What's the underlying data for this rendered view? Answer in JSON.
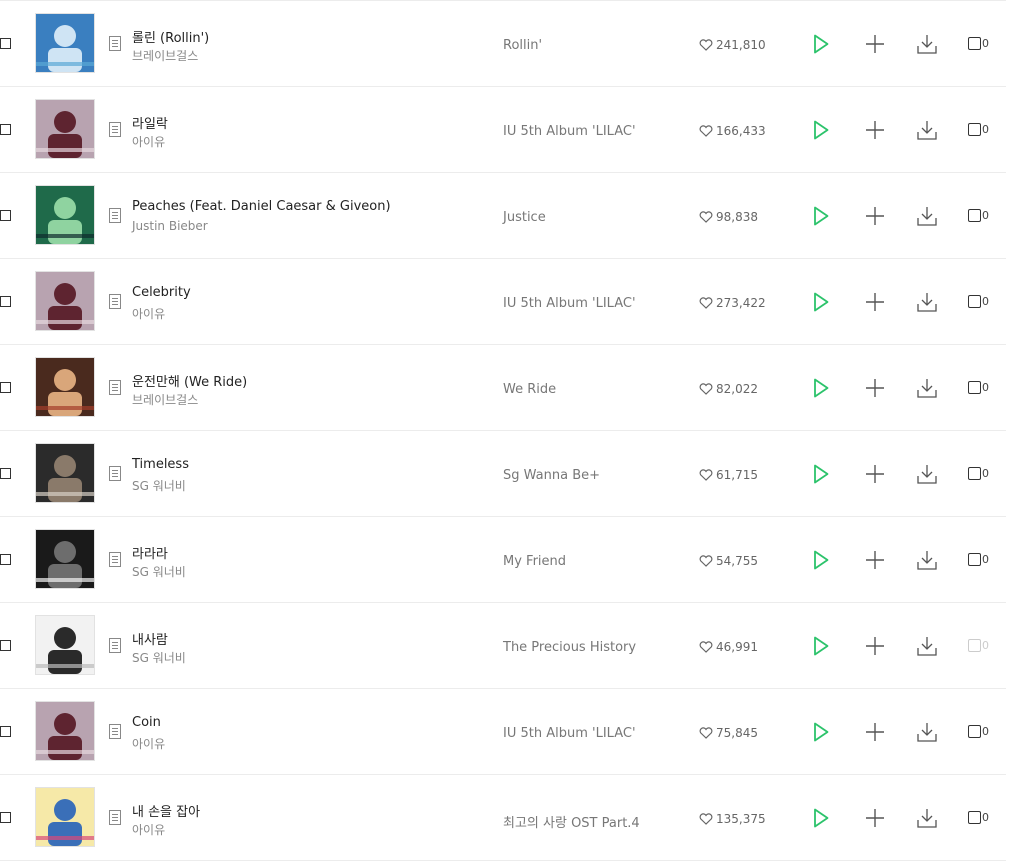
{
  "rows": [
    {
      "title": "롤린 (Rollin')",
      "artist": "브레이브걸스",
      "album": "Rollin'",
      "likes": "241,810",
      "mv_count": "0",
      "mv_disabled": false,
      "art": {
        "bg": "#3a7fc0",
        "fg": "#cfe4f4",
        "accent": "#5aa8d6"
      }
    },
    {
      "title": "라일락",
      "artist": "아이유",
      "album": "IU 5th Album 'LILAC'",
      "likes": "166,433",
      "mv_count": "0",
      "mv_disabled": false,
      "art": {
        "bg": "#b8a3b0",
        "fg": "#5e2430",
        "accent": "#e6d7de"
      }
    },
    {
      "title": "Peaches (Feat. Daniel Caesar & Giveon)",
      "artist": "Justin Bieber",
      "album": "Justice",
      "likes": "98,838",
      "mv_count": "0",
      "mv_disabled": false,
      "art": {
        "bg": "#1f6a4a",
        "fg": "#8fd3a0",
        "accent": "#0e2c2c"
      }
    },
    {
      "title": "Celebrity",
      "artist": "아이유",
      "album": "IU 5th Album 'LILAC'",
      "likes": "273,422",
      "mv_count": "0",
      "mv_disabled": false,
      "art": {
        "bg": "#b8a3b0",
        "fg": "#5e2430",
        "accent": "#e6d7de"
      }
    },
    {
      "title": "운전만해 (We Ride)",
      "artist": "브레이브걸스",
      "album": "We Ride",
      "likes": "82,022",
      "mv_count": "0",
      "mv_disabled": false,
      "art": {
        "bg": "#4a2a1e",
        "fg": "#d9a67a",
        "accent": "#a33d2a"
      }
    },
    {
      "title": "Timeless",
      "artist": "SG 워너비",
      "album": "Sg Wanna Be+",
      "likes": "61,715",
      "mv_count": "0",
      "mv_disabled": false,
      "art": {
        "bg": "#2b2b2b",
        "fg": "#8a7a6a",
        "accent": "#d6cfc4"
      }
    },
    {
      "title": "라라라",
      "artist": "SG 워너비",
      "album": "My Friend",
      "likes": "54,755",
      "mv_count": "0",
      "mv_disabled": false,
      "art": {
        "bg": "#1a1a1a",
        "fg": "#6d6d6d",
        "accent": "#f4f4f4"
      }
    },
    {
      "title": "내사람",
      "artist": "SG 워너비",
      "album": "The Precious History",
      "likes": "46,991",
      "mv_count": "0",
      "mv_disabled": true,
      "art": {
        "bg": "#f2f2f2",
        "fg": "#2a2a2a",
        "accent": "#bbbbbb"
      }
    },
    {
      "title": "Coin",
      "artist": "아이유",
      "album": "IU 5th Album 'LILAC'",
      "likes": "75,845",
      "mv_count": "0",
      "mv_disabled": false,
      "art": {
        "bg": "#b8a3b0",
        "fg": "#5e2430",
        "accent": "#e6d7de"
      }
    },
    {
      "title": "내 손을 잡아",
      "artist": "아이유",
      "album": "최고의 사랑 OST Part.4",
      "likes": "135,375",
      "mv_count": "0",
      "mv_disabled": false,
      "art": {
        "bg": "#f6e9a8",
        "fg": "#3a6fb8",
        "accent": "#d84a7a"
      }
    }
  ],
  "colors": {
    "play": "#2cc36b",
    "icon": "#555555",
    "disabled": "#cccccc"
  },
  "icons": {
    "doc": "lyrics-doc-icon",
    "like": "heart-icon",
    "play": "play-icon",
    "add": "plus-icon",
    "download": "download-icon",
    "mv": "mv-icon"
  }
}
